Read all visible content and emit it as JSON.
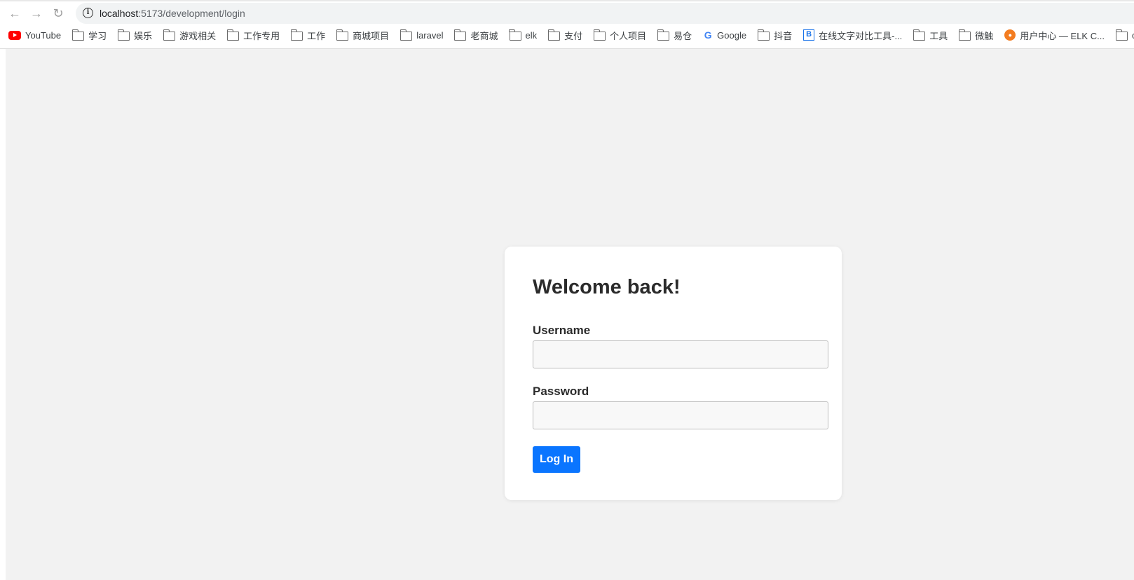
{
  "browser": {
    "url_host": "localhost",
    "url_path": ":5173/development/login",
    "bookmarks": [
      {
        "label": "YouTube",
        "icon": "youtube-icon"
      },
      {
        "label": "学习",
        "icon": "folder-icon"
      },
      {
        "label": "娱乐",
        "icon": "folder-icon"
      },
      {
        "label": "游戏相关",
        "icon": "folder-icon"
      },
      {
        "label": "工作专用",
        "icon": "folder-icon"
      },
      {
        "label": "工作",
        "icon": "folder-icon"
      },
      {
        "label": "商城项目",
        "icon": "folder-icon"
      },
      {
        "label": "laravel",
        "icon": "folder-icon"
      },
      {
        "label": "老商城",
        "icon": "folder-icon"
      },
      {
        "label": "elk",
        "icon": "folder-icon"
      },
      {
        "label": "支付",
        "icon": "folder-icon"
      },
      {
        "label": "个人项目",
        "icon": "folder-icon"
      },
      {
        "label": "易仓",
        "icon": "folder-icon"
      },
      {
        "label": "Google",
        "icon": "google-icon"
      },
      {
        "label": "抖音",
        "icon": "folder-icon"
      },
      {
        "label": "在线文字对比工具-...",
        "icon": "b-site-icon"
      },
      {
        "label": "工具",
        "icon": "folder-icon"
      },
      {
        "label": "微触",
        "icon": "folder-icon"
      },
      {
        "label": "用户中心 — ELK C...",
        "icon": "elk-site-icon"
      },
      {
        "label": "openA",
        "icon": "folder-icon"
      }
    ]
  },
  "login": {
    "title": "Welcome back!",
    "username_label": "Username",
    "username_value": "",
    "password_label": "Password",
    "password_value": "",
    "button_label": "Log In"
  },
  "colors": {
    "accent": "#0a75ff",
    "page_bg": "#f2f2f2",
    "card_bg": "#ffffff"
  }
}
